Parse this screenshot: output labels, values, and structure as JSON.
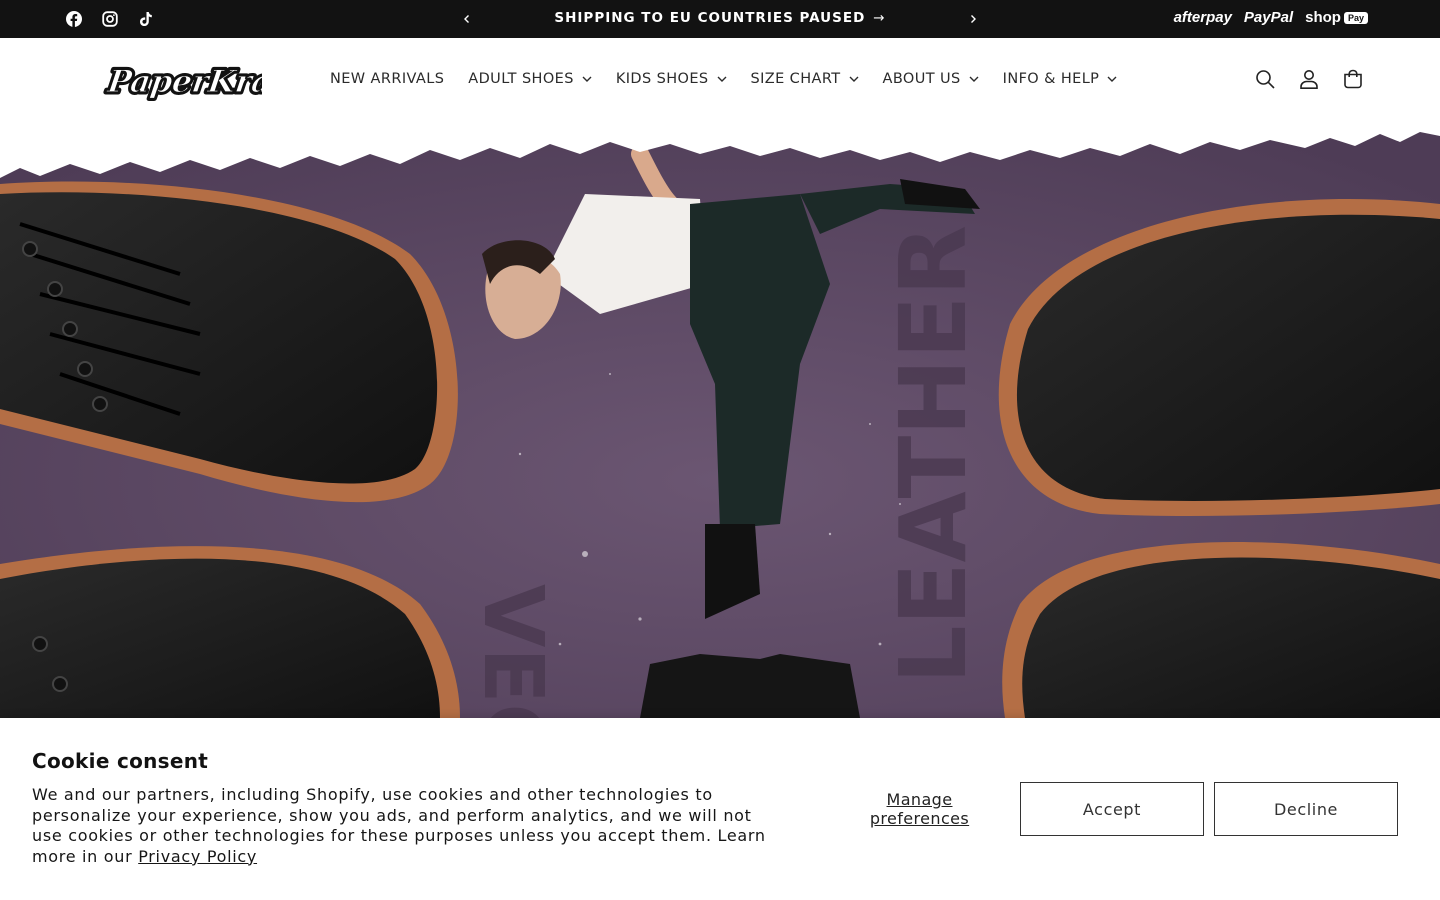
{
  "announcement": {
    "text": "SHIPPING TO EU COUNTRIES PAUSED",
    "arrow": "→",
    "social_icons": [
      "facebook-icon",
      "instagram-icon",
      "tiktok-icon"
    ],
    "payment": {
      "afterpay": "afterpay",
      "paypal": "PayPal",
      "shop": "shop",
      "shop_pill": "Pay"
    }
  },
  "header": {
    "logo_text": "PaperKrane",
    "nav": [
      {
        "label": "NEW ARRIVALS",
        "dropdown": false
      },
      {
        "label": "ADULT SHOES",
        "dropdown": true
      },
      {
        "label": "KIDS SHOES",
        "dropdown": true
      },
      {
        "label": "SIZE CHART",
        "dropdown": true
      },
      {
        "label": "ABOUT US",
        "dropdown": true
      },
      {
        "label": "INFO & HELP",
        "dropdown": true
      }
    ]
  },
  "hero": {
    "left_word": "VEGAN",
    "right_word": "LEATHER",
    "bg_color": "#5e4a66"
  },
  "cookie": {
    "title": "Cookie consent",
    "body": "We and our partners, including Shopify, use cookies and other technologies to personalize your experience, show you ads, and perform analytics, and we will not use cookies or other technologies for these purposes unless you accept them. Learn more in our ",
    "link": "Privacy Policy",
    "manage": "Manage preferences",
    "accept": "Accept",
    "decline": "Decline"
  }
}
